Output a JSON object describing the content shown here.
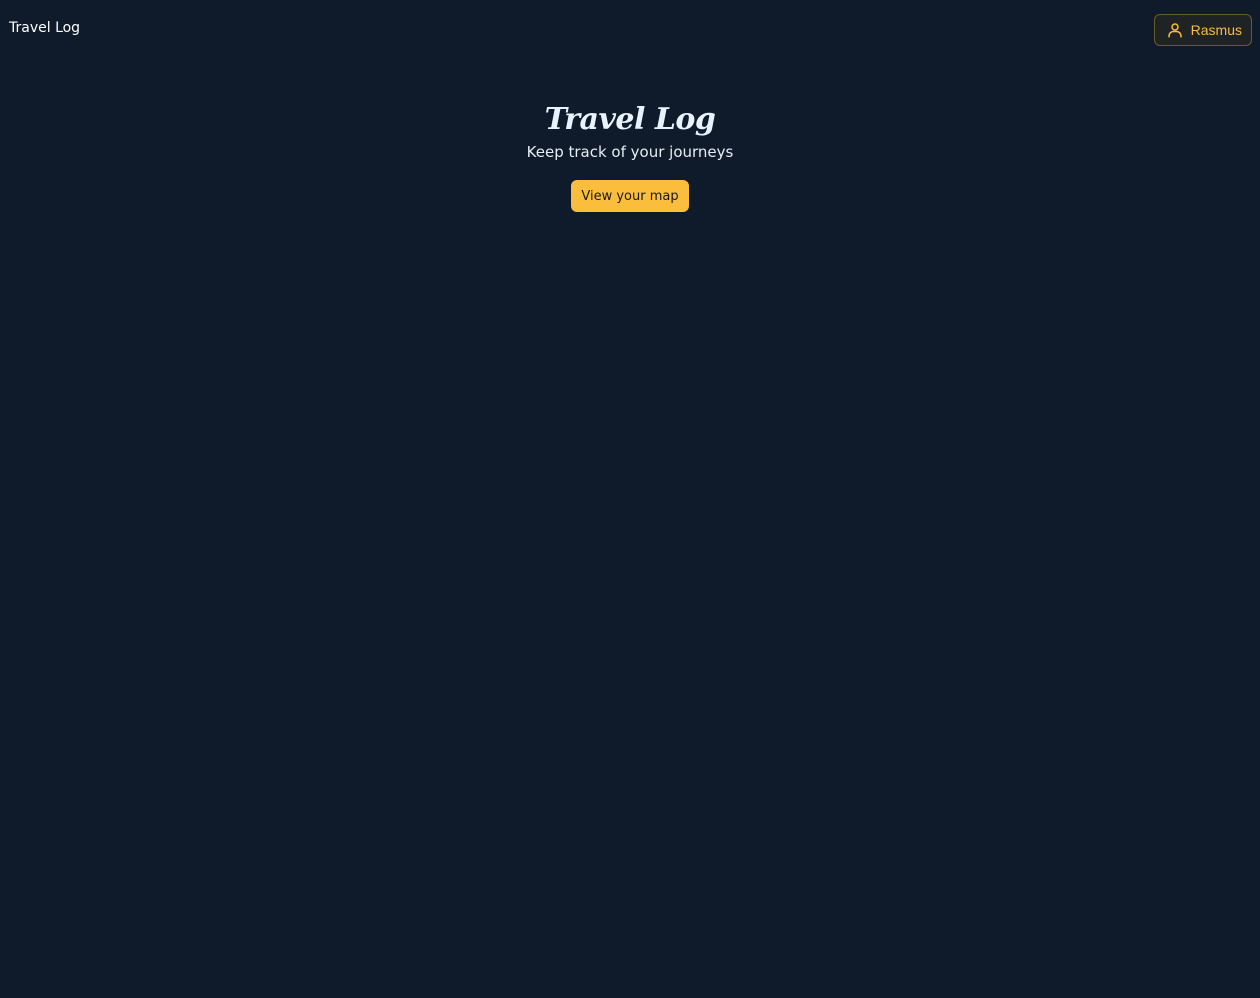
{
  "nav": {
    "brand": "Travel Log",
    "user_name": "Rasmus",
    "user_icon": "user-icon"
  },
  "hero": {
    "title": "Travel Log",
    "subtitle": "Keep track of your journeys",
    "cta_label": "View your map"
  },
  "colors": {
    "background": "#0f1a2a",
    "accent": "#fbbd3c"
  }
}
